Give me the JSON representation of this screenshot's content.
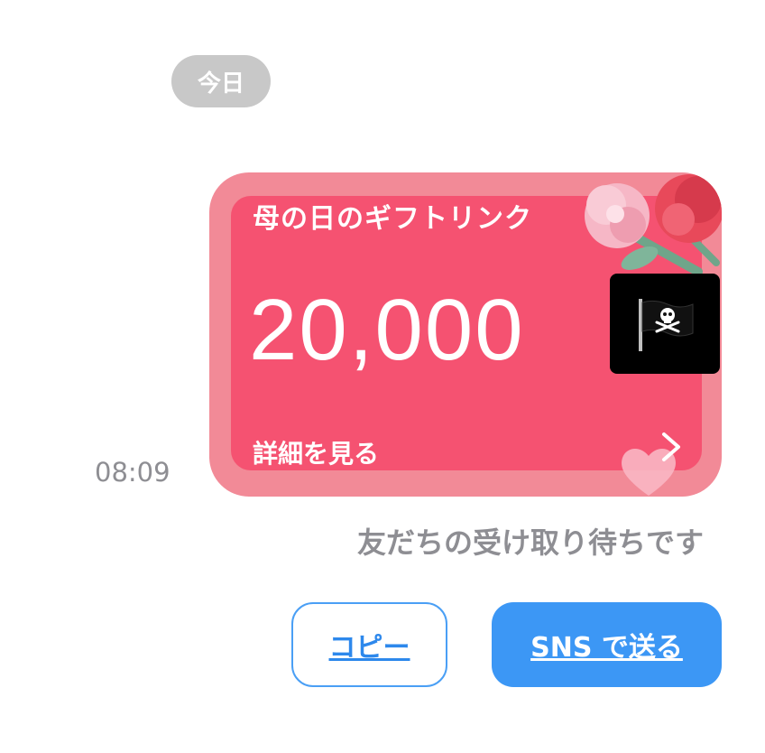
{
  "chat": {
    "date_label": "今日",
    "timestamp": "08:09"
  },
  "gift_card": {
    "title": "母の日のギフトリンク",
    "amount": "20,000",
    "details_link": "詳細を見る",
    "chevron_icon": "chevron-right-icon",
    "decoration_icons": [
      "carnation-flowers-icon",
      "heart-icon"
    ],
    "colors": {
      "outer": "#f28a97",
      "inner": "#f55271"
    }
  },
  "overlay": {
    "icon": "pirate-flag-icon",
    "emoji": "🏴‍☠️"
  },
  "status": {
    "text": "友だちの受け取り待ちです"
  },
  "actions": {
    "copy_label": "コピー",
    "sns_label": "SNS で送る",
    "accent": "#3c97f5"
  }
}
